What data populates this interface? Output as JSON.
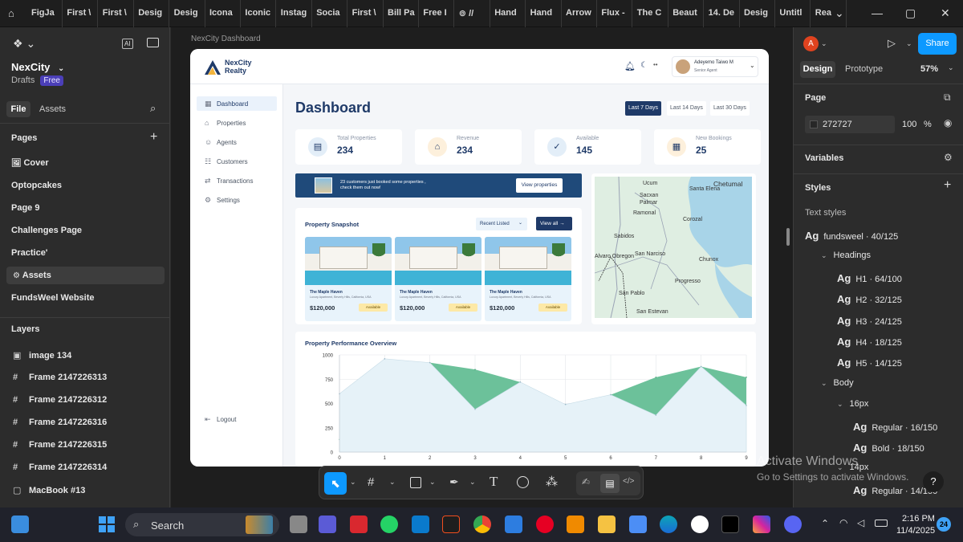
{
  "browser_tabs": [
    "FigJa",
    "First \\",
    "First \\",
    "Desig",
    "Desig",
    "Icona",
    "Iconic",
    "Instag",
    "Socia",
    "First \\",
    "Bill Pa",
    "Free I",
    "⊚ //",
    "Hand",
    "Hand",
    "Arrow",
    "Flux -",
    "The C",
    "Beaut",
    "14. De",
    "Desig",
    "Untitl",
    "Rea"
  ],
  "figma_left": {
    "project": "NexCity",
    "drafts": "Drafts",
    "plan_badge": "Free",
    "tab_file": "File",
    "tab_assets": "Assets",
    "pages_header": "Pages",
    "pages": [
      "Cover",
      "Optopcakes",
      "Page 9",
      "Challenges Page",
      "Practice'",
      "Assets",
      "FundsWeel Website"
    ],
    "layers_header": "Layers",
    "layers": [
      "image 134",
      "Frame 2147226313",
      "Frame 2147226312",
      "Frame 2147226316",
      "Frame 2147226315",
      "Frame 2147226314",
      "MacBook #13"
    ]
  },
  "canvas": {
    "frame_label": "NexCity Dashboard"
  },
  "dashboard": {
    "logo_line1": "NexCity",
    "logo_line2": "Realty",
    "user_name": "Adeyemo Taiwo M",
    "user_role": "Senior Agent",
    "nav": [
      "Dashboard",
      "Properties",
      "Agents",
      "Customers",
      "Transactions",
      "Settings"
    ],
    "logout": "Logout",
    "title": "Dashboard",
    "ranges": [
      "Last 7 Days",
      "Last 14 Days",
      "Last 30 Days"
    ],
    "stats": [
      {
        "label": "Total Properties",
        "value": "234"
      },
      {
        "label": "Revenue",
        "value": "234"
      },
      {
        "label": "Available",
        "value": "145"
      },
      {
        "label": "New Bookings",
        "value": "25"
      }
    ],
    "banner_text_1": "23 customers just booked some properties ,",
    "banner_text_2": "check them out now!",
    "banner_button": "View properties",
    "snapshot_title": "Property Snapshot",
    "snapshot_filter": "Recent Listed",
    "snapshot_viewall": "View all",
    "properties": [
      {
        "name": "The Maple Haven",
        "addr": "Luxury Apartment, Beverly Hills, California, USA",
        "price": "$120,000",
        "status": "Available"
      },
      {
        "name": "The Maple Haven",
        "addr": "Luxury Apartment, Beverly Hills, California, USA",
        "price": "$120,000",
        "status": "Available"
      },
      {
        "name": "The Maple Haven",
        "addr": "Luxury Apartment, Beverly Hills, California, USA",
        "price": "$120,000",
        "status": "Available"
      }
    ],
    "map_labels": [
      "Ucum",
      "Sacxan",
      "Palmar",
      "Ramonal",
      "Sabidos",
      "Alvaro Obregon",
      "San Narciso",
      "Corozal",
      "Chunox",
      "Progresso",
      "San Pablo",
      "San Estevan",
      "Chetumal",
      "Santa Elena"
    ],
    "perf_title": "Property Performance Overview"
  },
  "chart_data": {
    "type": "area",
    "title": "Property Performance Overview",
    "x": [
      0,
      1,
      2,
      3,
      4,
      5,
      6,
      7,
      8,
      9
    ],
    "ylim": [
      0,
      1000
    ],
    "yticks": [
      0,
      250,
      500,
      750,
      1000
    ],
    "series": [
      {
        "values": [
          130,
          950,
          920,
          850,
          720,
          490,
          590,
          770,
          880,
          770
        ],
        "color": "#6cc19a"
      },
      {
        "values": [
          600,
          960,
          920,
          440,
          720,
          490,
          590,
          380,
          880,
          480
        ],
        "color": "#e6f2f8"
      }
    ],
    "grid": true
  },
  "figma_right": {
    "avatar_letter": "A",
    "share": "Share",
    "tab_design": "Design",
    "tab_prototype": "Prototype",
    "zoom": "57%",
    "page_header": "Page",
    "page_color": "272727",
    "page_opacity": "100",
    "page_opacity_unit": "%",
    "variables": "Variables",
    "styles": "Styles",
    "text_styles": "Text styles",
    "text_style_items": [
      {
        "label": "fundsweel · 40/125",
        "indent": 0,
        "ag": true
      },
      {
        "label": "Headings",
        "indent": 1,
        "ag": false
      },
      {
        "label": "H1 · 64/100",
        "indent": 2,
        "ag": true
      },
      {
        "label": "H2 · 32/125",
        "indent": 2,
        "ag": true
      },
      {
        "label": "H3 · 24/125",
        "indent": 2,
        "ag": true
      },
      {
        "label": "H4 · 18/125",
        "indent": 2,
        "ag": true
      },
      {
        "label": "H5 · 14/125",
        "indent": 2,
        "ag": true
      },
      {
        "label": "Body",
        "indent": 1,
        "ag": false
      },
      {
        "label": "16px",
        "indent": 2,
        "ag": false
      },
      {
        "label": "Regular · 16/150",
        "indent": 3,
        "ag": true
      },
      {
        "label": "Bold · 18/150",
        "indent": 3,
        "ag": true
      },
      {
        "label": "14px",
        "indent": 2,
        "ag": false
      },
      {
        "label": "Regular · 14/150",
        "indent": 3,
        "ag": true
      }
    ],
    "help": "?"
  },
  "watermark": {
    "line1": "Activate Windows",
    "line2": "Go to Settings to activate Windows."
  },
  "taskbar": {
    "search": "Search",
    "time": "2:16 PM",
    "date": "11/4/2025",
    "badge": "24"
  }
}
